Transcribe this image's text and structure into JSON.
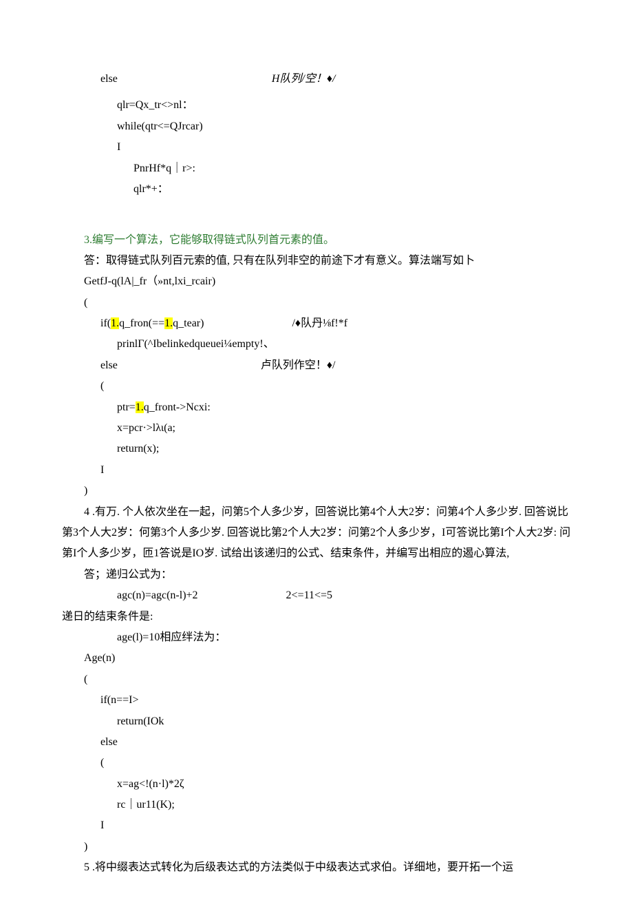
{
  "block1": {
    "l1_left": "else",
    "l1_right": "H队列/空！♦/",
    "l2": "qlr=Qx_tr<>nl：",
    "l3": "while(qtr<=QJrcar)",
    "l4": "I",
    "l5": "PnrHf*q｜r>:",
    "l6": "qlr*+："
  },
  "q3": {
    "title": "3.编写一个算法，它能够取得链式队列首元素的值。",
    "ans": "答：取得链式队列百元索的值, 只有在队列非空的前途下才有意义。算法端写如卜",
    "l1": "GetfJ-q(lA|_fr（»nt,lxi_rcair)",
    "l2": "(",
    "if_left_a": "if(",
    "if_left_b": "1.",
    "if_left_c": "q_fron(==",
    "if_left_d": "1.",
    "if_left_e": "q_tear)",
    "if_right": "/♦队丹⅛f!*f",
    "l4": "prinlΓ(^Ibelinkedqueuei¼empty!、",
    "else_left": "else",
    "else_right": "卢队列作空！♦/",
    "l6": "(",
    "l7a": "ptr=",
    "l7b": "1.",
    "l7c": "q_front->Ncxi:",
    "l8": "x=pcr·>lλι(a;",
    "l9": "return(x);",
    "l10": "I",
    "l11": ")"
  },
  "q4": {
    "num": "4",
    "text1": " .有万. 个人依次坐在一起，问第5个人多少岁，回答说比第4个人大2岁：问第4个人多少岁. 回答说比第3个人大2岁：何第3个人多少岁. 回答说比第2个人大2岁：问第2个人多少岁，I可答说比第I个人大2岁: 问第I个人多少岁，匝1答说是IO岁. 试给出该递归的公式、结束条件，并编写出相应的遏心算法,",
    "ans_label": "答；递归公式为：",
    "formula_left": "agc(n)=agc(n-l)+2",
    "formula_right": "2<=11<=5",
    "end_cond_label": "递日的结束条件是:",
    "end_cond_val": "age(l)=10相应绊法为：",
    "c1": "Age(n)",
    "c2": "(",
    "c3": "if(n==I>",
    "c4": "return(IOk",
    "c5": "else",
    "c6": "(",
    "c7": "x=ag<!(n·l)*2ζ",
    "c8": "rc｜ur11(K);",
    "c9": "I",
    "c10": ")"
  },
  "q5": {
    "num": "5",
    "text": " .将中缀表达式转化为后级表达式的方法类似于中级表达式求伯。详细地，要开拓一个运"
  }
}
